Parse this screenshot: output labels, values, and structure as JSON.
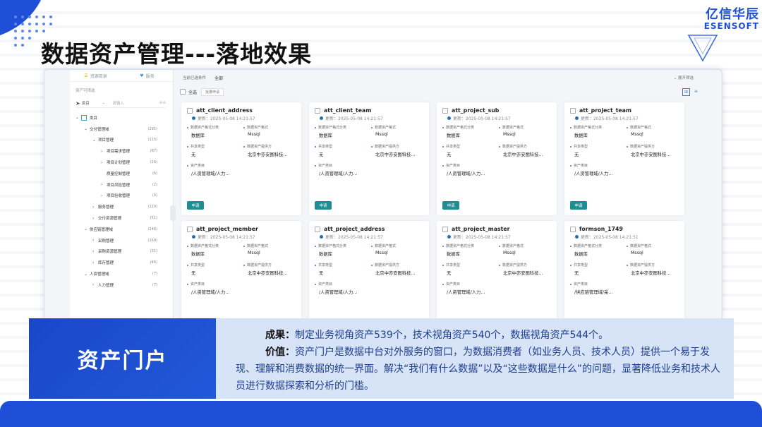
{
  "colors": {
    "brand": "#1e4fd6",
    "banner_left": "#1f4fd8",
    "banner_right": "#d7e3f7",
    "apply_button": "#1f8e92"
  },
  "logo": {
    "cn": "亿信华辰",
    "en": "ESENSOFT"
  },
  "title": "数据资产管理---落地效果",
  "sidebar": {
    "tabs": [
      "资源目录",
      "服务"
    ],
    "filter_label": "资产可筛选",
    "select": {
      "value": "类目",
      "placeholder": "请输入"
    },
    "tree": [
      {
        "label": "类目",
        "count": "",
        "level": 0,
        "arrow": "v",
        "box": true
      },
      {
        "label": "交付管理域",
        "count": "(295)",
        "level": 1,
        "arrow": "v"
      },
      {
        "label": "项目管理",
        "count": "(115)",
        "level": 2,
        "arrow": "v"
      },
      {
        "label": "项目需求管理",
        "count": "(87)",
        "level": 3,
        "arrow": ">"
      },
      {
        "label": "项目计划管理",
        "count": "(16)",
        "level": 3,
        "arrow": ">"
      },
      {
        "label": "质量控制管理",
        "count": "(6)",
        "level": 3,
        "arrow": ""
      },
      {
        "label": "项目风险管理",
        "count": "(2)",
        "level": 3,
        "arrow": ">"
      },
      {
        "label": "项目验收管理",
        "count": "(4)",
        "level": 3,
        "arrow": ">"
      },
      {
        "label": "服务管理",
        "count": "(120)",
        "level": 2,
        "arrow": ">"
      },
      {
        "label": "交付资源管理",
        "count": "(51)",
        "level": 2,
        "arrow": ">"
      },
      {
        "label": "供应链管理域",
        "count": "(246)",
        "level": 1,
        "arrow": "v"
      },
      {
        "label": "采购管理",
        "count": "(169)",
        "level": 2,
        "arrow": ">"
      },
      {
        "label": "采购资源管理",
        "count": "(31)",
        "level": 2,
        "arrow": ">"
      },
      {
        "label": "库存管理",
        "count": "(46)",
        "level": 2,
        "arrow": ">"
      },
      {
        "label": "人资管理域",
        "count": "(7)",
        "level": 1,
        "arrow": "v"
      },
      {
        "label": "人力管理",
        "count": "(7)",
        "level": 2,
        "arrow": ">"
      }
    ]
  },
  "toolbar": {
    "filter_label": "当前已选条件",
    "all_label": "全部",
    "expand": "展开筛选",
    "select_all": "全选",
    "batch": "批量申请"
  },
  "field_labels": {
    "format_class": "数据资产格式分类",
    "format": "数据资产格式",
    "share": "共享类型",
    "provider": "数据资产提供方",
    "catalog": "资产类目"
  },
  "apply_label": "申请",
  "cards": [
    {
      "name": "att_client_address",
      "updated": "更新：2025-05-08 14:21:57",
      "format_class": "数据库",
      "format": "Mssql",
      "share": "无",
      "provider": "北京中亦安图科技...",
      "catalog": "/人资管理域/人力..."
    },
    {
      "name": "att_client_team",
      "updated": "更新：2025-05-08 14:21:57",
      "format_class": "数据库",
      "format": "Mssql",
      "share": "无",
      "provider": "北京中亦安图科技...",
      "catalog": "/人资管理域/人力..."
    },
    {
      "name": "att_project_sub",
      "updated": "更新：2025-05-08 14:21:57",
      "format_class": "数据库",
      "format": "Mssql",
      "share": "无",
      "provider": "北京中亦安图科技...",
      "catalog": "/人资管理域/人力..."
    },
    {
      "name": "att_project_team",
      "updated": "更新：2025-05-08 14:21:57",
      "format_class": "数据库",
      "format": "Mssql",
      "share": "无",
      "provider": "北京中亦安图科技...",
      "catalog": "/人资管理域/人力..."
    },
    {
      "name": "att_project_member",
      "updated": "更新：2025-05-08 14:21:57",
      "format_class": "数据库",
      "format": "Mssql",
      "share": "无",
      "provider": "北京中亦安图科技...",
      "catalog": "/人资管理域/人力..."
    },
    {
      "name": "att_project_address",
      "updated": "更新：2025-05-08 14:21:57",
      "format_class": "数据库",
      "format": "Mssql",
      "share": "无",
      "provider": "北京中亦安图科技...",
      "catalog": "/人资管理域/人力..."
    },
    {
      "name": "att_project_master",
      "updated": "更新：2025-05-08 14:21:57",
      "format_class": "数据库",
      "format": "Mssql",
      "share": "无",
      "provider": "北京中亦安图科技...",
      "catalog": "/人资管理域/人力..."
    },
    {
      "name": "formson_1749",
      "updated": "更新：2025-05-08 14:21:51",
      "format_class": "数据库",
      "format": "Mssql",
      "share": "无",
      "provider": "北京中亦安图科技...",
      "catalog": "/供应链管理域/采..."
    }
  ],
  "banner": {
    "heading": "资产门户",
    "result_label": "成果：",
    "result_text": "制定业务视角资产539个，技术视角资产540个，数据视角资产544个。",
    "value_label": "价值：",
    "value_line1": "资产门户是数据中台对外服务的窗口，为数据消费者（如业务人员、技术人员）提供一个易于发",
    "value_line2": "现、理解和消费数据的统一界面。解决“我们有什么数据”以及“这些数据是什么”的问题，显著降低业务和技术人",
    "value_line3": "员进行数据探索和分析的门槛。"
  }
}
